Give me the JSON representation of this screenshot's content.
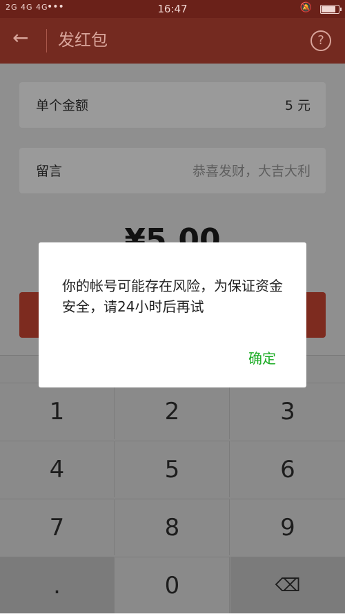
{
  "status": {
    "signal": "2G 4G 4G",
    "dots": "•••",
    "time": "16:47"
  },
  "nav": {
    "back_icon": "←",
    "title": "发红包",
    "help_icon": "?"
  },
  "form": {
    "amount_label": "单个金额",
    "amount_value": "5 元",
    "message_label": "留言",
    "message_placeholder": "恭喜发财，大吉大利"
  },
  "total": "¥5.00",
  "keypad": {
    "keys": [
      "1",
      "2",
      "3",
      "4",
      "5",
      "6",
      "7",
      "8",
      "9",
      ".",
      "0",
      "⌫"
    ]
  },
  "dialog": {
    "message": "你的帐号可能存在风险，为保证资金安全，请24小时后再试",
    "confirm": "确定"
  },
  "colors": {
    "accent_green": "#1aab23",
    "nav_red": "#742a20"
  }
}
